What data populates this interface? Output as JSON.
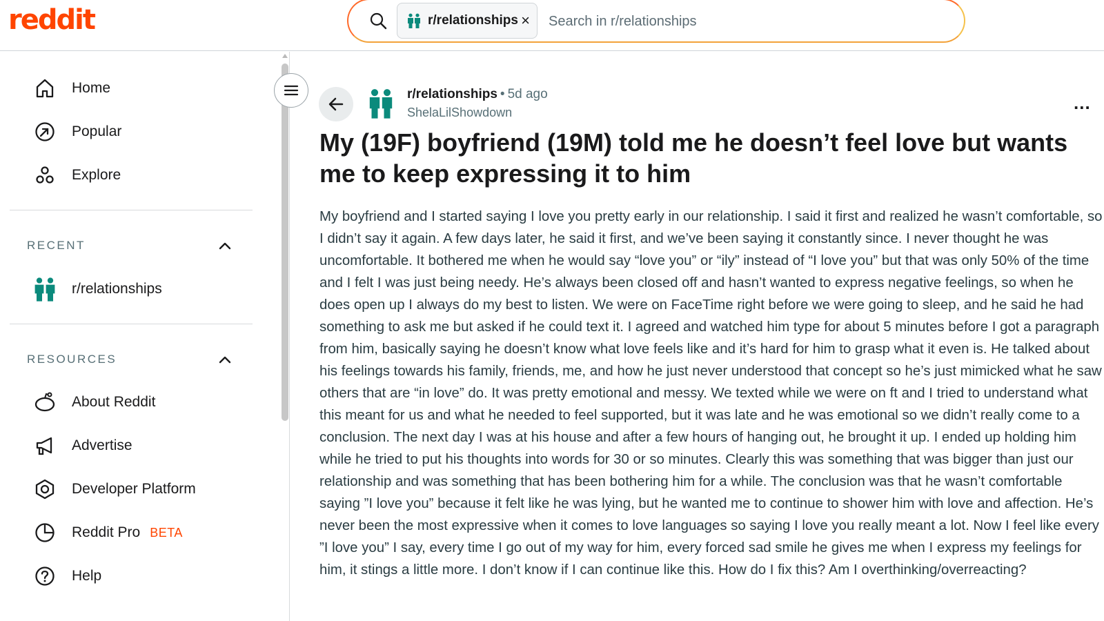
{
  "header": {
    "logo": "reddit",
    "search": {
      "chip_label": "r/relationships",
      "chip_close": "×",
      "placeholder": "Search in r/relationships"
    }
  },
  "sidebar": {
    "nav": [
      {
        "label": "Home",
        "icon": "home-icon"
      },
      {
        "label": "Popular",
        "icon": "popular-icon"
      },
      {
        "label": "Explore",
        "icon": "explore-icon"
      }
    ],
    "recent": {
      "title": "RECENT",
      "items": [
        {
          "label": "r/relationships",
          "icon": "subreddit-icon"
        }
      ]
    },
    "resources": {
      "title": "RESOURCES",
      "items": [
        {
          "label": "About Reddit",
          "icon": "about-icon"
        },
        {
          "label": "Advertise",
          "icon": "megaphone-icon"
        },
        {
          "label": "Developer Platform",
          "icon": "developer-icon"
        },
        {
          "label": "Reddit Pro",
          "badge": "BETA",
          "icon": "pro-icon"
        },
        {
          "label": "Help",
          "icon": "help-icon"
        }
      ]
    }
  },
  "post": {
    "subreddit": "r/relationships",
    "separator": "•",
    "age": "5d ago",
    "author": "ShelaLilShowdown",
    "more": "...",
    "title": "My (19F) boyfriend (19M) told me he doesn’t feel love but wants me to keep expressing it to him",
    "body": "My boyfriend and I started saying I love you pretty early in our relationship. I said it first and realized he wasn’t comfortable, so I didn’t say it again. A few days later, he said it first, and we’ve been saying it constantly since. I never thought he was uncomfortable. It bothered me when he would say “love you” or “ily” instead of “I love you” but that was only 50% of the time and I felt I was just being needy. He’s always been closed off and hasn’t wanted to express negative feelings, so when he does open up I always do my best to listen. We were on FaceTime right before we were going to sleep, and he said he had something to ask me but asked if he could text it. I agreed and watched him type for about 5 minutes before I got a paragraph from him, basically saying he doesn’t know what love feels like and it’s hard for him to grasp what it even is. He talked about his feelings towards his family, friends, me, and how he just never understood that concept so he’s just mimicked what he saw others that are “in love” do. It was pretty emotional and messy. We texted while we were on ft and I tried to understand what this meant for us and what he needed to feel supported, but it was late and he was emotional so we didn’t really come to a conclusion. The next day I was at his house and after a few hours of hanging out, he brought it up. I ended up holding him while he tried to put his thoughts into words for 30 or so minutes. Clearly this was something that was bigger than just our relationship and was something that has been bothering him for a while. The conclusion was that he wasn’t comfortable saying ”I love you” because it felt like he was lying, but he wanted me to continue to shower him with love and affection. He’s never been the most expressive when it comes to love languages so saying I love you really meant a lot. Now I feel like every ”I love you” I say, every time I go out of my way for him, every forced sad smile he gives me when I express my feelings for him, it stings a little more. I don’t know if I can continue like this. How do I fix this? Am I overthinking/overreacting?"
  },
  "colors": {
    "brand": "#ff4500",
    "subreddit_icon": "#0b8a7c",
    "text_muted": "#576f76"
  }
}
